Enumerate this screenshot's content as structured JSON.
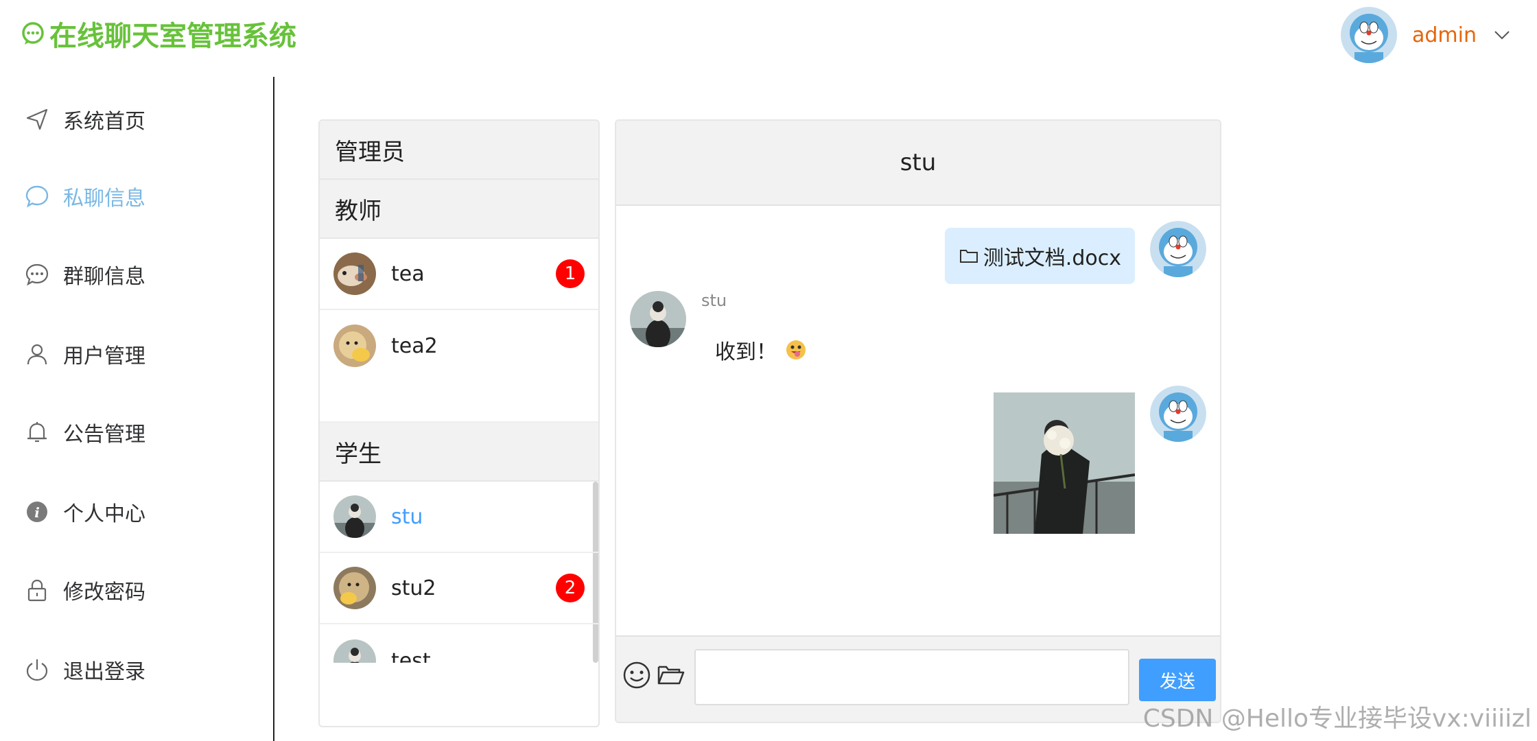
{
  "app": {
    "title": "在线聊天室管理系统",
    "accent": "#67c23a"
  },
  "user": {
    "name": "admin",
    "avatar_icon": "doraemon-avatar"
  },
  "sidebar": {
    "items": [
      {
        "label": "系统首页",
        "icon": "navigation-arrow-icon"
      },
      {
        "label": "私聊信息",
        "icon": "chat-bubble-icon",
        "active": true
      },
      {
        "label": "群聊信息",
        "icon": "chat-dots-icon"
      },
      {
        "label": "用户管理",
        "icon": "user-icon"
      },
      {
        "label": "公告管理",
        "icon": "bell-icon"
      },
      {
        "label": "个人中心",
        "icon": "info-icon"
      },
      {
        "label": "修改密码",
        "icon": "lock-icon"
      },
      {
        "label": "退出登录",
        "icon": "power-icon"
      }
    ]
  },
  "contacts": {
    "admin_group": "管理员",
    "teacher_group": "教师",
    "teachers": [
      {
        "name": "tea",
        "badge": "1"
      },
      {
        "name": "tea2",
        "badge": ""
      }
    ],
    "student_group": "学生",
    "students": [
      {
        "name": "stu",
        "badge": "",
        "active": true
      },
      {
        "name": "stu2",
        "badge": "2"
      },
      {
        "name": "test",
        "badge": ""
      }
    ]
  },
  "chat": {
    "title": "stu",
    "messages": {
      "file_name": "测试文档.docx",
      "sender": "stu",
      "text": "收到！"
    },
    "send_label": "发送",
    "input_value": ""
  },
  "watermark": "CSDN @Hello专业接毕设vx:viiiizl"
}
